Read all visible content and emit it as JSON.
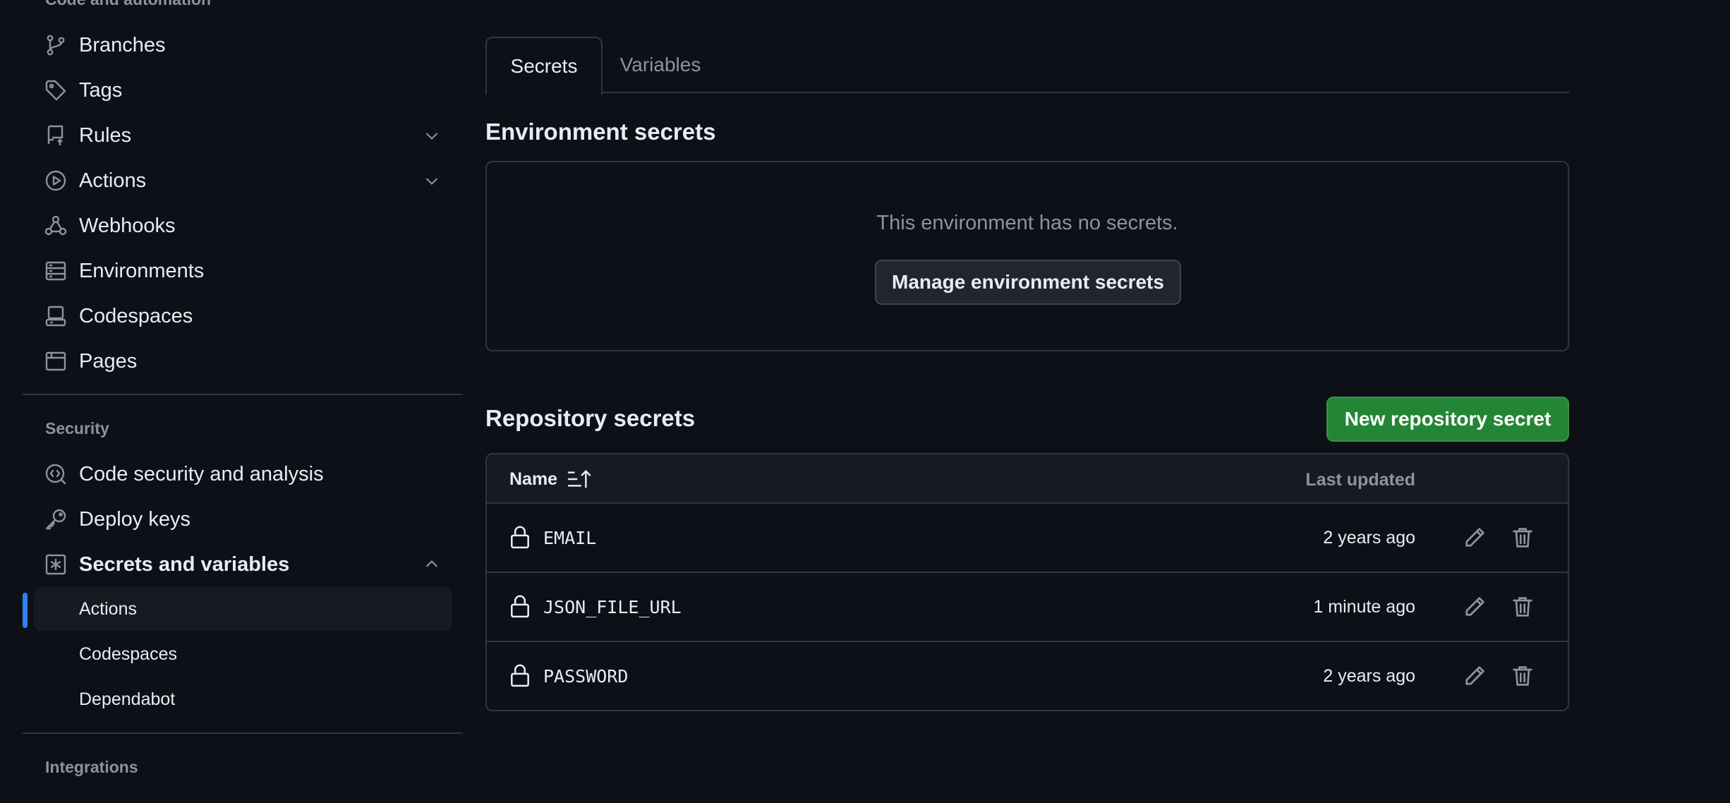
{
  "sidebar": {
    "section_code_automation": "Code and automation",
    "items_top": [
      {
        "label": "Branches",
        "icon": "git-branch-icon"
      },
      {
        "label": "Tags",
        "icon": "tag-icon"
      },
      {
        "label": "Rules",
        "icon": "repo-push-icon"
      },
      {
        "label": "Actions",
        "icon": "play-icon"
      },
      {
        "label": "Webhooks",
        "icon": "webhook-icon"
      },
      {
        "label": "Environments",
        "icon": "server-icon"
      },
      {
        "label": "Codespaces",
        "icon": "codespaces-icon"
      },
      {
        "label": "Pages",
        "icon": "browser-icon"
      }
    ],
    "section_security": "Security",
    "items_security": [
      {
        "label": "Code security and analysis",
        "icon": "codescan-icon"
      },
      {
        "label": "Deploy keys",
        "icon": "key-icon"
      },
      {
        "label": "Secrets and variables",
        "icon": "asterisk-icon"
      }
    ],
    "sub_items": [
      {
        "label": "Actions",
        "active": true
      },
      {
        "label": "Codespaces",
        "active": false
      },
      {
        "label": "Dependabot",
        "active": false
      }
    ],
    "section_integrations": "Integrations"
  },
  "tabs": [
    {
      "label": "Secrets",
      "active": true
    },
    {
      "label": "Variables",
      "active": false
    }
  ],
  "environment": {
    "title": "Environment secrets",
    "empty_text": "This environment has no secrets.",
    "manage_button": "Manage environment secrets"
  },
  "repository": {
    "title": "Repository secrets",
    "new_button": "New repository secret",
    "col_name": "Name",
    "col_updated": "Last updated",
    "rows": [
      {
        "name": "EMAIL",
        "updated": "2 years ago"
      },
      {
        "name": "JSON_FILE_URL",
        "updated": "1 minute ago"
      },
      {
        "name": "PASSWORD",
        "updated": "2 years ago"
      }
    ]
  },
  "colors": {
    "background": "#0d1117",
    "border": "#30363d",
    "accent": "#2f81f7",
    "primary_button": "#238636",
    "muted_text": "#8b949e"
  }
}
